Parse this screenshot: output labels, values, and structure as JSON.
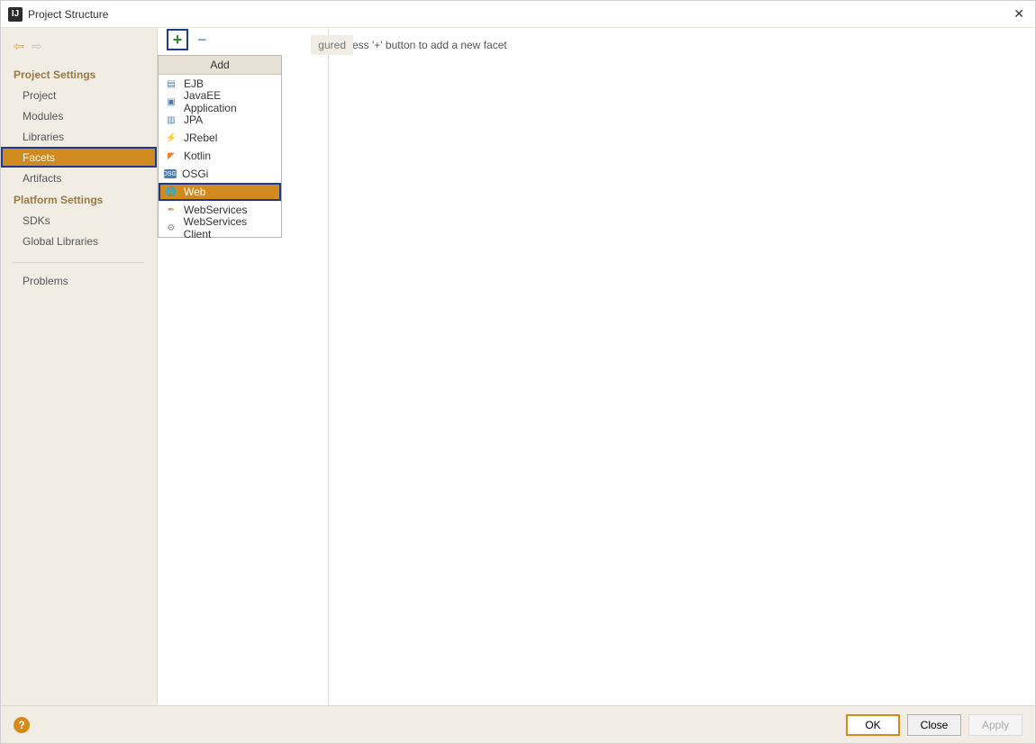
{
  "window": {
    "title": "Project Structure"
  },
  "sidebar": {
    "section1": {
      "header": "Project Settings",
      "items": [
        {
          "label": "Project"
        },
        {
          "label": "Modules"
        },
        {
          "label": "Libraries"
        },
        {
          "label": "Facets",
          "selected": true
        },
        {
          "label": "Artifacts"
        }
      ]
    },
    "section2": {
      "header": "Platform Settings",
      "items": [
        {
          "label": "SDKs"
        },
        {
          "label": "Global Libraries"
        }
      ]
    },
    "section3": {
      "items": [
        {
          "label": "Problems"
        }
      ]
    }
  },
  "mid": {
    "placeholder_fragment": "gured"
  },
  "popup": {
    "header": "Add",
    "items": [
      {
        "label": "EJB",
        "icon": "📘",
        "color": "#4a7db0"
      },
      {
        "label": "JavaEE Application",
        "icon": "📄",
        "color": "#4a7db0"
      },
      {
        "label": "JPA",
        "icon": "📃",
        "color": "#4a7db0"
      },
      {
        "label": "JRebel",
        "icon": "🚀",
        "color": "#3aa84a"
      },
      {
        "label": "Kotlin",
        "icon": "◤",
        "color": "#e87a2a"
      },
      {
        "label": "OSGi",
        "icon": "▦",
        "color": "#4a7db0"
      },
      {
        "label": "Web",
        "icon": "🌐",
        "color": "#4aa8d8",
        "selected": true
      },
      {
        "label": "WebServices",
        "icon": "🪶",
        "color": "#c8a050"
      },
      {
        "label": "WebServices Client",
        "icon": "⚙",
        "color": "#888"
      }
    ]
  },
  "right": {
    "hint": "Press '+' button to add a new facet"
  },
  "footer": {
    "ok": "OK",
    "close": "Close",
    "apply": "Apply"
  }
}
